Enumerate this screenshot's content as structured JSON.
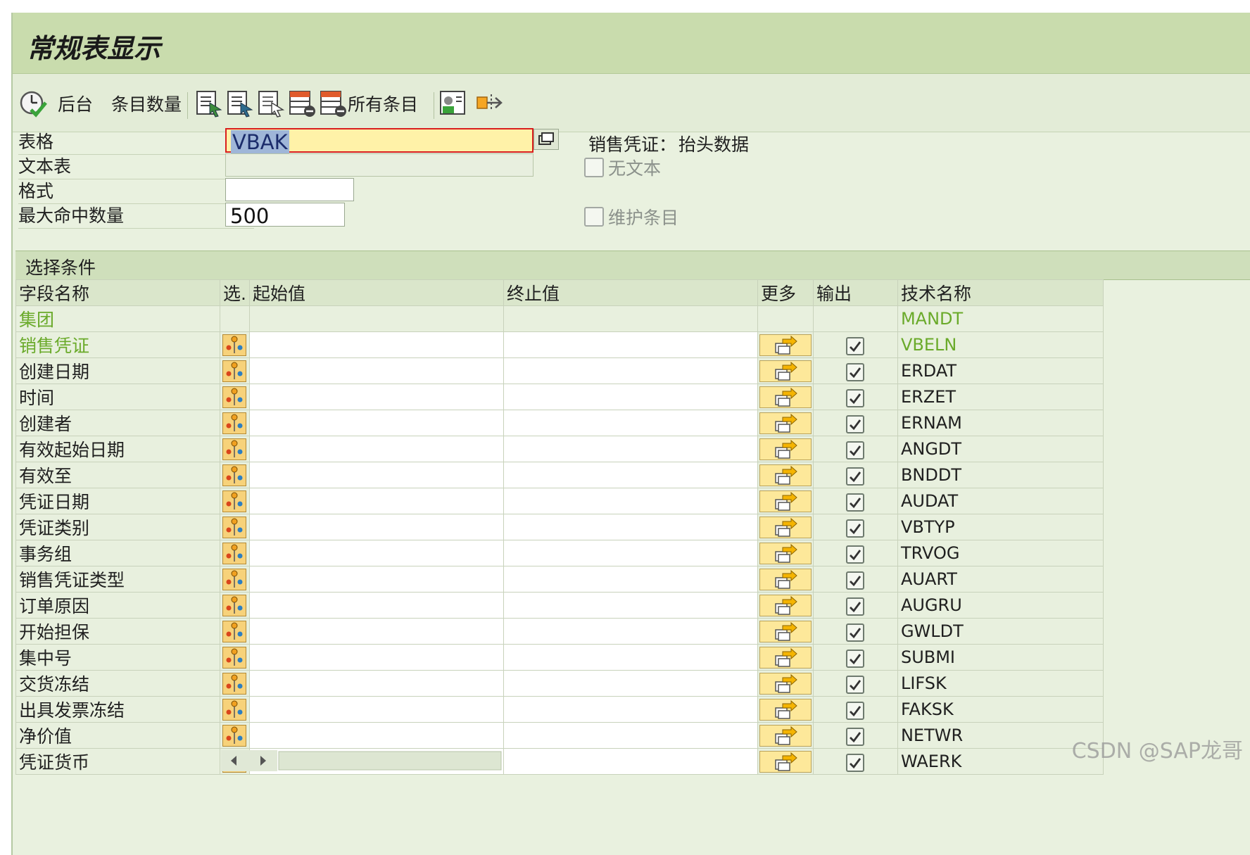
{
  "window": {
    "title": "常规表显示"
  },
  "toolbar": {
    "background_label": "后台",
    "entry_count_label": "条目数量",
    "all_entries_label": "所有条目"
  },
  "form": {
    "table_label": "表格",
    "table_value": "VBAK",
    "table_desc_label": "销售凭证：",
    "table_desc_value": "抬头数据",
    "text_table_label": "文本表",
    "text_table_value": "",
    "no_text_label": "无文本",
    "layout_label": "格式",
    "layout_value": "",
    "max_hits_label": "最大命中数量",
    "max_hits_value": "500",
    "maintain_entries_label": "维护条目"
  },
  "selection": {
    "section_title": "选择条件",
    "columns": [
      "字段名称",
      "选.",
      "起始值",
      "终止值",
      "更多",
      "输出",
      "技术名称"
    ],
    "rows": [
      {
        "name": "集团",
        "tech": "MANDT",
        "key": true,
        "has_controls": false
      },
      {
        "name": "销售凭证",
        "tech": "VBELN",
        "key": true,
        "has_controls": true
      },
      {
        "name": "创建日期",
        "tech": "ERDAT",
        "key": false,
        "has_controls": true
      },
      {
        "name": "时间",
        "tech": "ERZET",
        "key": false,
        "has_controls": true
      },
      {
        "name": "创建者",
        "tech": "ERNAM",
        "key": false,
        "has_controls": true
      },
      {
        "name": "有效起始日期",
        "tech": "ANGDT",
        "key": false,
        "has_controls": true
      },
      {
        "name": "有效至",
        "tech": "BNDDT",
        "key": false,
        "has_controls": true
      },
      {
        "name": "凭证日期",
        "tech": "AUDAT",
        "key": false,
        "has_controls": true
      },
      {
        "name": "凭证类别",
        "tech": "VBTYP",
        "key": false,
        "has_controls": true
      },
      {
        "name": "事务组",
        "tech": "TRVOG",
        "key": false,
        "has_controls": true
      },
      {
        "name": "销售凭证类型",
        "tech": "AUART",
        "key": false,
        "has_controls": true
      },
      {
        "name": "订单原因",
        "tech": "AUGRU",
        "key": false,
        "has_controls": true
      },
      {
        "name": "开始担保",
        "tech": "GWLDT",
        "key": false,
        "has_controls": true
      },
      {
        "name": "集中号",
        "tech": "SUBMI",
        "key": false,
        "has_controls": true
      },
      {
        "name": "交货冻结",
        "tech": "LIFSK",
        "key": false,
        "has_controls": true
      },
      {
        "name": "出具发票冻结",
        "tech": "FAKSK",
        "key": false,
        "has_controls": true
      },
      {
        "name": "净价值",
        "tech": "NETWR",
        "key": false,
        "has_controls": true
      },
      {
        "name": "凭证货币",
        "tech": "WAERK",
        "key": false,
        "has_controls": true
      }
    ]
  },
  "watermark": "CSDN @SAP龙哥",
  "colors": {
    "title_bar": "#c9dcad",
    "key_field": "#6aaa2a",
    "active_input": "#fff2a8"
  }
}
